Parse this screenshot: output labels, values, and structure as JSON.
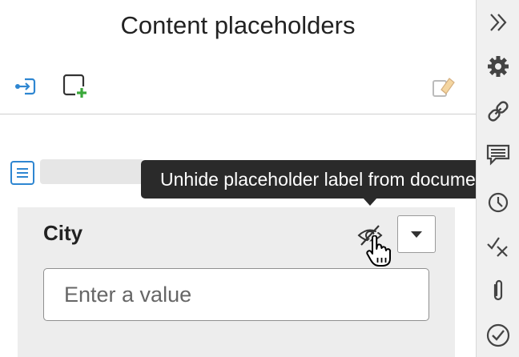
{
  "panel": {
    "title": "Content placeholders"
  },
  "toolbar": {
    "left_icons": [
      "go-to-placeholder-icon",
      "add-placeholder-icon"
    ],
    "right_icon": "clear-placeholders-icon"
  },
  "tooltip": {
    "text": "Unhide placeholder label from document"
  },
  "placeholder": {
    "label": "City",
    "input_placeholder": "Enter a value",
    "input_value": ""
  },
  "sidebar": {
    "icons": [
      "double-chevron-right-icon",
      "gear-icon",
      "link-icon",
      "comment-icon",
      "history-icon",
      "check-x-icon",
      "paperclip-icon",
      "check-circle-icon"
    ]
  },
  "colors": {
    "accent_blue": "#2e86d1",
    "add_green": "#3aa83a",
    "tooltip_bg": "#2a2a2a",
    "card_bg": "#ededed",
    "sidebar_bg": "#f0f0f0"
  }
}
